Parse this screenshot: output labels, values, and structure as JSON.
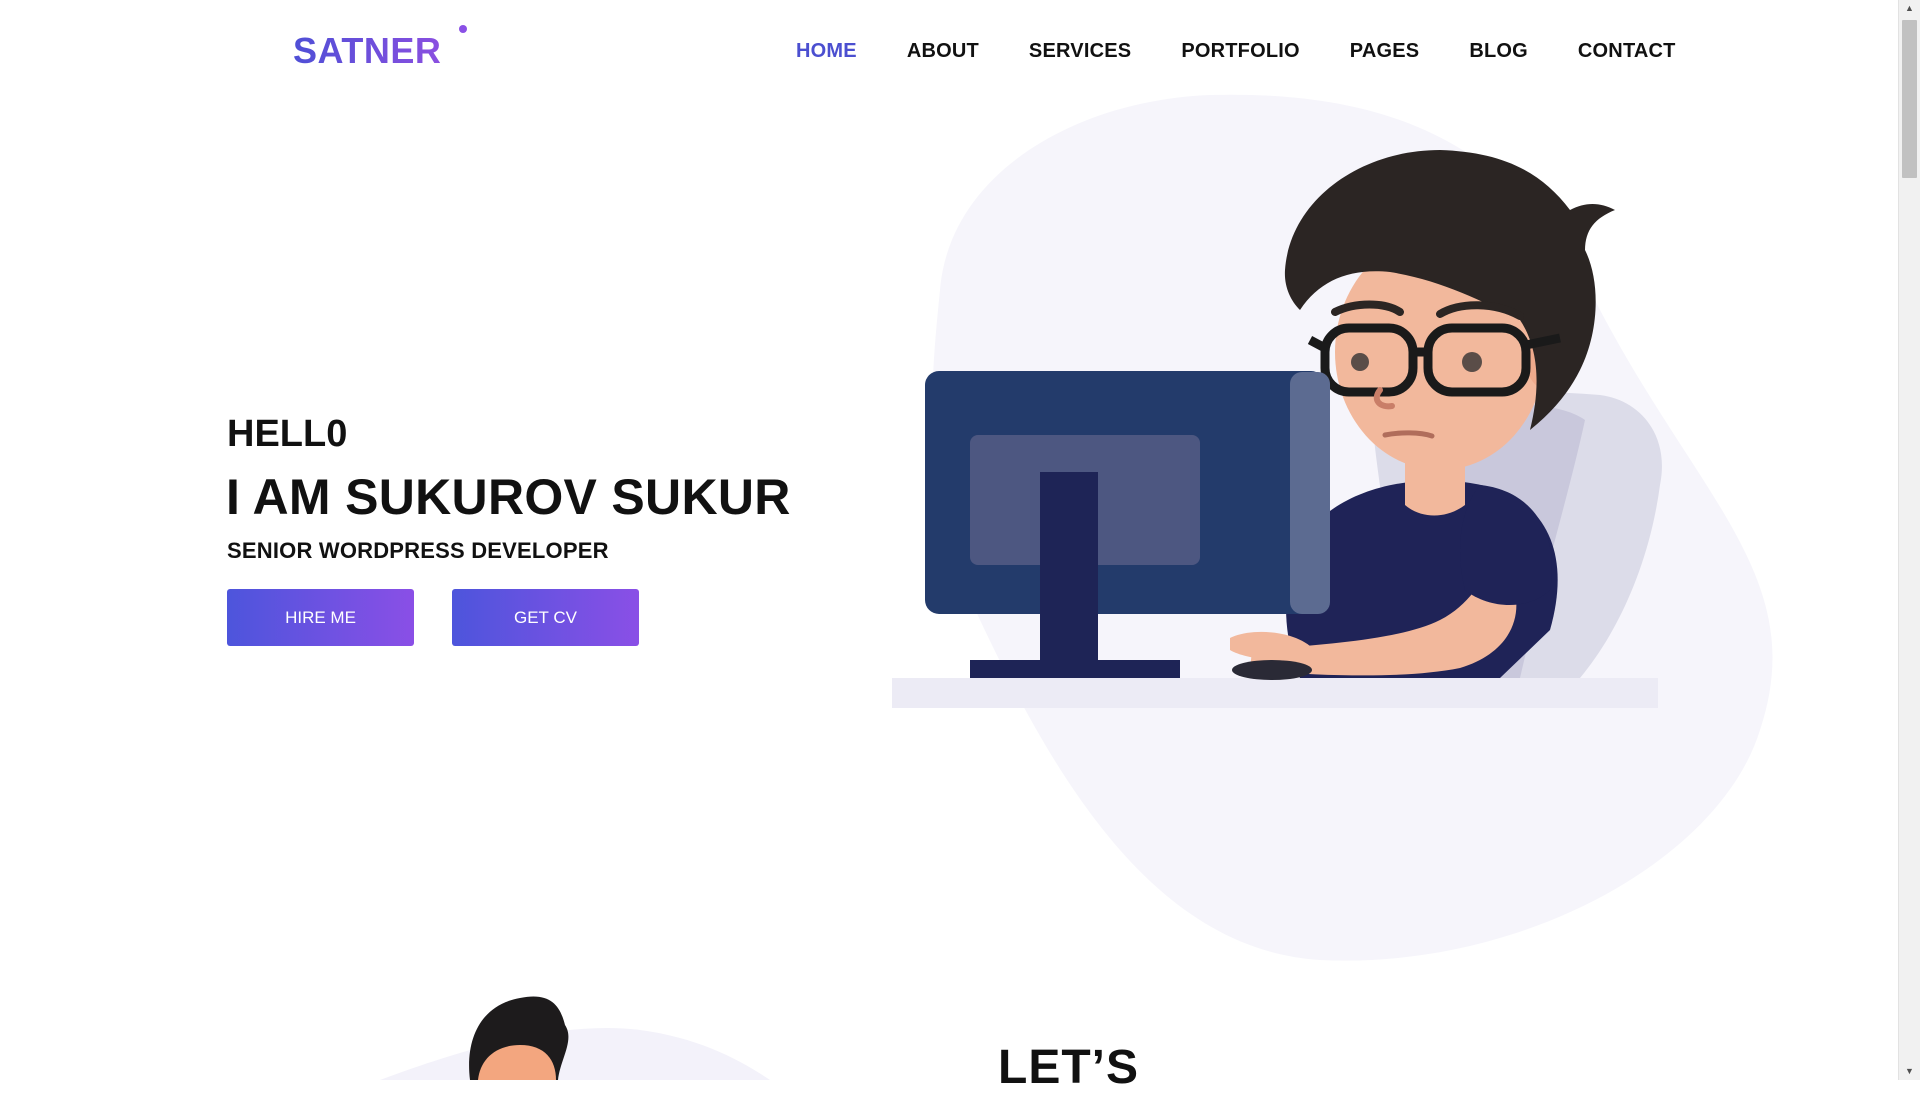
{
  "brand": {
    "name": "SATNER"
  },
  "nav": {
    "items": [
      {
        "label": "HOME",
        "active": true
      },
      {
        "label": "ABOUT"
      },
      {
        "label": "SERVICES"
      },
      {
        "label": "PORTFOLIO"
      },
      {
        "label": "PAGES"
      },
      {
        "label": "BLOG"
      },
      {
        "label": "CONTACT"
      }
    ]
  },
  "hero": {
    "greeting": "HELL0",
    "name": "I AM SUKUROV SUKUR",
    "role": "SENIOR WORDPRESS DEVELOPER",
    "buttons": {
      "hire": "HIRE ME",
      "cv": "GET CV"
    }
  },
  "next_section": {
    "heading": "LET’S"
  },
  "colors": {
    "accent": "#4b4fd0",
    "gradient_start": "#4d55dc",
    "gradient_end": "#8a4fe6"
  }
}
